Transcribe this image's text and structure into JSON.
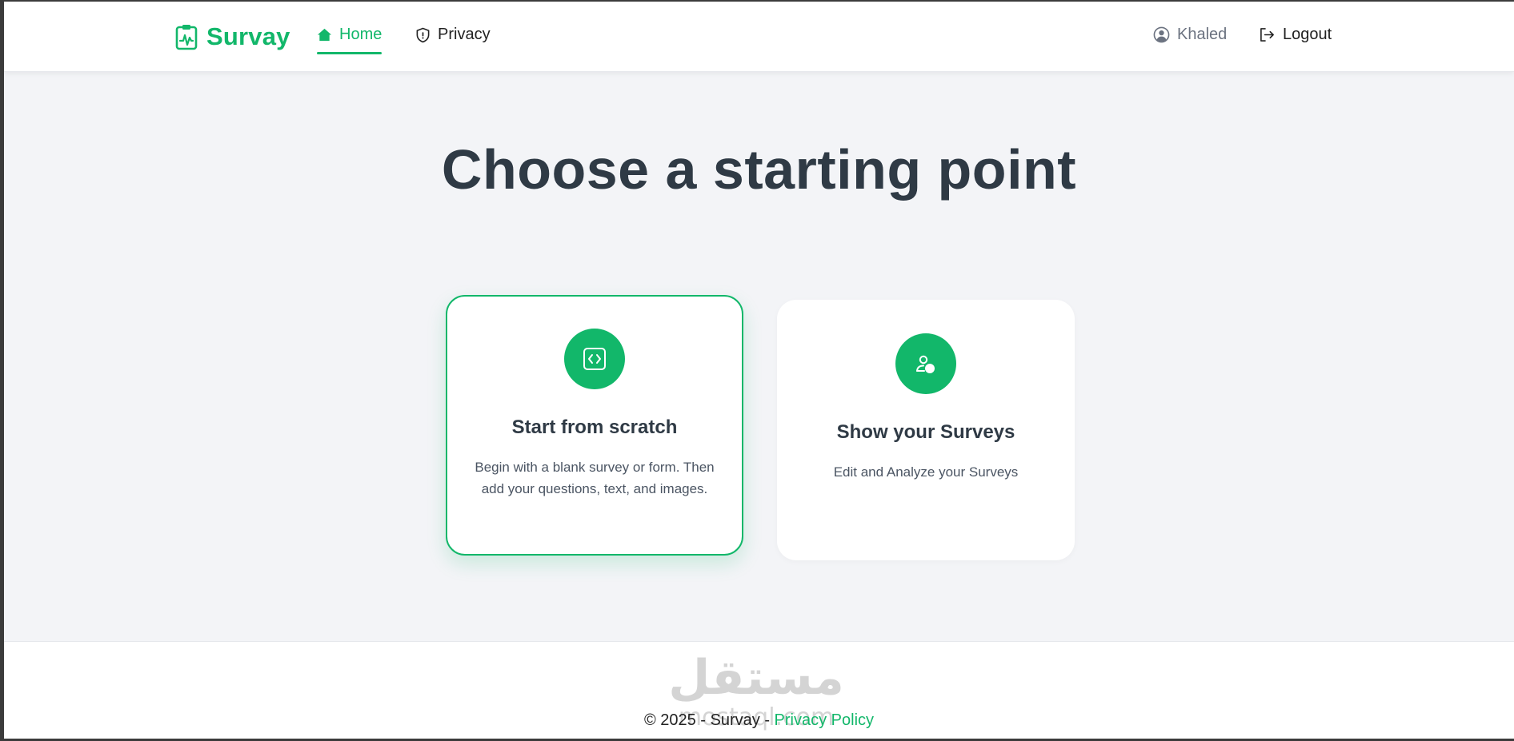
{
  "header": {
    "brand": "Survay",
    "nav": {
      "home": "Home",
      "privacy": "Privacy"
    },
    "user": {
      "name": "Khaled",
      "logout": "Logout"
    }
  },
  "main": {
    "title": "Choose a starting point",
    "cards": [
      {
        "title": "Start from scratch",
        "description": "Begin with a blank survey or form. Then add your questions, text, and images.",
        "icon": "code-square-icon",
        "selected": true
      },
      {
        "title": "Show your Surveys",
        "description": "Edit and Analyze your Surveys",
        "icon": "user-check-icon",
        "selected": false
      }
    ]
  },
  "footer": {
    "copyright": "© 2025 - Survay - ",
    "privacy_link": "Privacy Policy",
    "watermark": {
      "arabic": "مستقل",
      "latin": "mostaql.com"
    }
  },
  "colors": {
    "accent": "#12b76a",
    "heading": "#2f3a45",
    "background": "#f3f4f7"
  }
}
